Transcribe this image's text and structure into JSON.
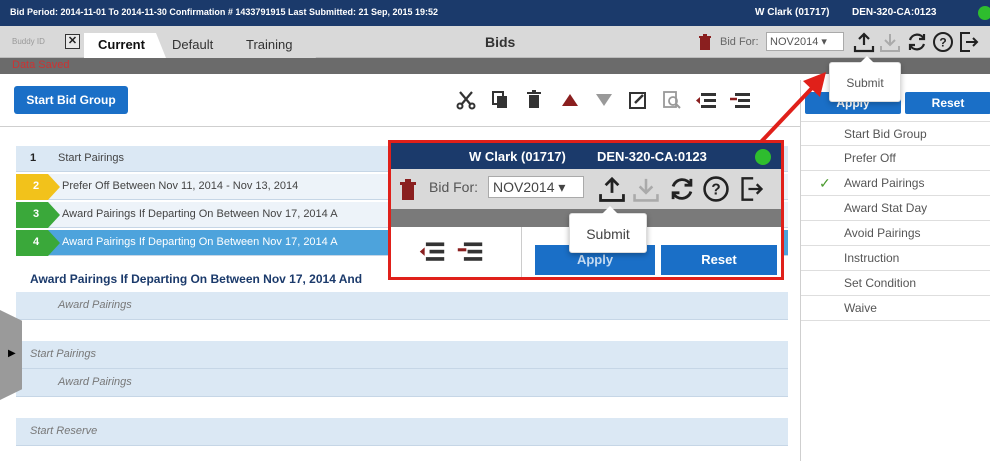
{
  "topbar": {
    "period": "Bid Period: 2014-11-01 To 2014-11-30 Confirmation # 1433791915 Last Submitted: 21 Sep, 2015 19:52",
    "user": "W Clark (01717)",
    "base": "DEN-320-CA:0123",
    "status_color": "#2ebd2e"
  },
  "tabbar": {
    "buddy_label": "Buddy ID",
    "tabs": [
      "Current",
      "Default",
      "Training"
    ],
    "title": "Bids",
    "bid_for_label": "Bid For:",
    "bid_for_value": "NOV2014"
  },
  "status": {
    "message": "Data Saved"
  },
  "main": {
    "start_group_button": "Start Bid Group",
    "rows": [
      {
        "num": "1",
        "text": "Start Pairings"
      },
      {
        "num": "2",
        "text": "Prefer Off Between Nov 11, 2014 - Nov 13, 2014",
        "tag_color": "#f2c21b"
      },
      {
        "num": "3",
        "text": "Award Pairings If Departing On Between Nov 17, 2014 A",
        "tag_color": "#3aa83a"
      },
      {
        "num": "4",
        "text": "Award Pairings If Departing On Between Nov 17, 2014 A",
        "tag_color": "#3aa83a"
      }
    ],
    "selected_line": "Award Pairings If Departing On Between Nov 17, 2014 And",
    "sub_rows": [
      "Award Pairings",
      "Start Pairings",
      "Award Pairings",
      "Start Reserve"
    ]
  },
  "right_panel": {
    "apply": "Apply",
    "reset": "Reset",
    "items": [
      "Start Bid Group",
      "Prefer Off",
      "Award Pairings",
      "Award Stat Day",
      "Avoid Pairings",
      "Instruction",
      "Set Condition",
      "Waive"
    ],
    "checked": "Award Pairings"
  },
  "callout": {
    "label": "Submit"
  },
  "zoom": {
    "user": "W Clark (01717)",
    "base": "DEN-320-CA:0123",
    "bid_for_label": "Bid For:",
    "bid_for_value": "NOV2014",
    "submit": "Submit",
    "apply": "Apply",
    "reset": "Reset"
  },
  "colors": {
    "navy": "#1b3a6b",
    "blue": "#1a6fc7",
    "highlight": "#e0201a"
  }
}
